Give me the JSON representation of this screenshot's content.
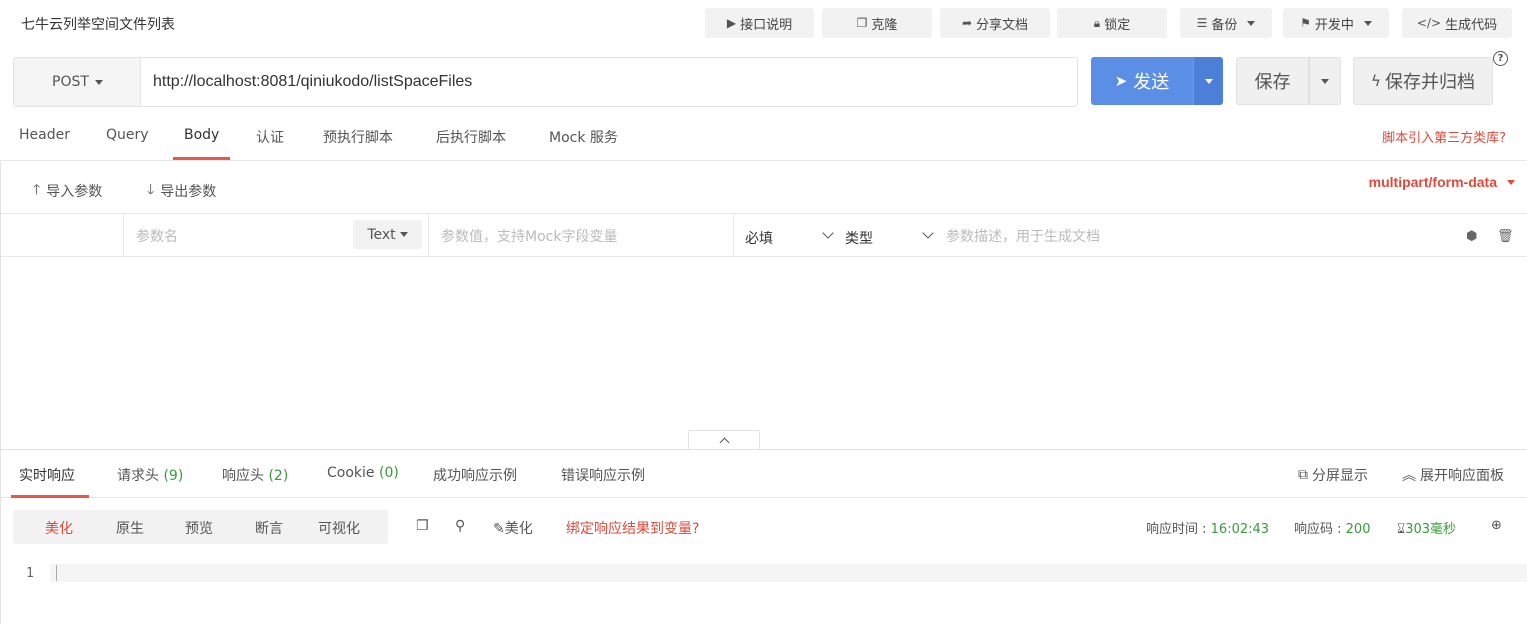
{
  "page": {
    "title": "七牛云列举空间文件列表"
  },
  "toolbar": {
    "doc": "接口说明",
    "clone": "克隆",
    "share": "分享文档",
    "lock": "锁定",
    "backup": "备份",
    "status": "开发中",
    "codegen": "生成代码"
  },
  "request": {
    "method": "POST",
    "url": "http://localhost:8081/qiniukodo/listSpaceFiles",
    "send": "发送",
    "save": "保存",
    "save_archive": "保存并归档"
  },
  "req_tabs": [
    "Header",
    "Query",
    "Body",
    "认证",
    "预执行脚本",
    "后执行脚本",
    "Mock 服务"
  ],
  "req_tab_active": "Body",
  "script_link": "脚本引入第三方类库?",
  "params": {
    "import": "导入参数",
    "export": "导出参数",
    "content_type": "multipart/form-data",
    "name_placeholder": "参数名",
    "type_select": "Text",
    "value_placeholder": "参数值，支持Mock字段变量",
    "required": "必填",
    "datatype": "类型",
    "desc_placeholder": "参数描述，用于生成文档"
  },
  "resp_tabs": {
    "realtime": "实时响应",
    "req_headers": "请求头",
    "req_headers_count": "(9)",
    "resp_headers": "响应头",
    "resp_headers_count": "(2)",
    "cookie": "Cookie",
    "cookie_count": "(0)",
    "success_example": "成功响应示例",
    "error_example": "错误响应示例",
    "split_view": "分屏显示",
    "expand_panel": "展开响应面板"
  },
  "view": {
    "modes": [
      "美化",
      "原生",
      "预览",
      "断言",
      "可视化"
    ],
    "active_mode": "美化",
    "beautify": "美化",
    "bind_var": "绑定响应结果到变量?",
    "time_label": "响应时间 : ",
    "time_value": "16:02:43",
    "code_label": "响应码 : ",
    "code_value": "200",
    "duration": "303毫秒"
  },
  "editor": {
    "line_numbers": [
      "1"
    ]
  },
  "colors": {
    "accent_red": "#e8574a",
    "send_blue": "#5b8fe6",
    "ok_green": "#3a9a3a"
  }
}
